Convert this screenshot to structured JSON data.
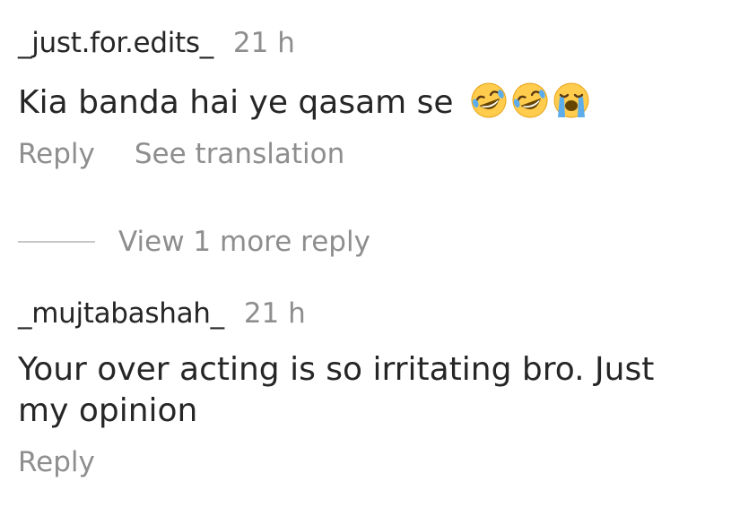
{
  "comments": [
    {
      "username": "_just.for.edits_",
      "time": "21 h",
      "text": "Kia banda hai ye qasam se",
      "emojis": [
        "rolling-on-floor-laughing-emoji",
        "rolling-on-floor-laughing-emoji",
        "loudly-crying-emoji"
      ],
      "actions": {
        "reply": "Reply",
        "translate": "See translation"
      }
    },
    {
      "username": "_mujtabashah_",
      "time": "21 h",
      "text": "Your over acting is so irritating bro. Just my opinion",
      "actions": {
        "reply": "Reply"
      }
    }
  ],
  "view_more": {
    "label": "View 1 more reply"
  },
  "colors": {
    "text_primary": "#262626",
    "text_secondary": "#8e8e8e",
    "thread_line": "#c7c7c7"
  }
}
